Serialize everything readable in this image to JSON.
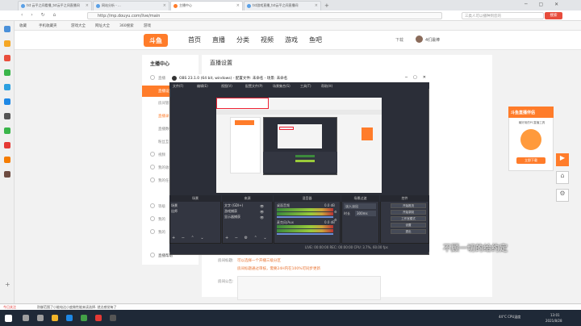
{
  "browser": {
    "tabs": [
      {
        "label": "tst 云平之间看播_tst云平之间直播间"
      },
      {
        "label": "网站分析 - ..."
      },
      {
        "label": "主播中心"
      },
      {
        "label": "tst游戏直播_tst云平之间直播间"
      }
    ],
    "url": "http://mp.douyu.com/live/main",
    "search_placeholder": "三类人可以播种到您的",
    "search_button": "搜索",
    "bookmarks": [
      "收藏",
      "手机收藏夹",
      "游戏大全",
      "网址大全",
      "360搜索",
      "游戏"
    ]
  },
  "site": {
    "logo": "斗鱼",
    "nav": [
      "首页",
      "直播",
      "分类",
      "视频",
      "游戏",
      "鱼吧"
    ],
    "download": "下载",
    "username": "4们最棒",
    "sidebar_title": "主播中心",
    "sidebar_items": [
      "直播",
      "直播设置",
      "房间管理",
      "直播录",
      "直播数据",
      "粉丝互动",
      "视频",
      "我的收益",
      "我的任务",
      "等级",
      "我的",
      "我的",
      "直播帮助"
    ],
    "content_title": "直播设置",
    "form_labels": [
      "房间标题:",
      "房间公告:"
    ],
    "form_notes": [
      "可以选择一个开播三级分区",
      "房间标题通过审核，需要24H内在100%可同步更新"
    ]
  },
  "obs": {
    "title": "OBS 23.1.0 (64 bit, windows) - 配置文件: 未命名 - 场景: 未命名",
    "menu": [
      "文件(F)",
      "编辑(E)",
      "视图(V)",
      "配置文件(P)",
      "场景集合(S)",
      "工具(T)",
      "帮助(H)"
    ],
    "panels": [
      "场景",
      "来源",
      "混音器",
      "场景过渡",
      "控件"
    ],
    "scenes": [
      "场景",
      "出师"
    ],
    "sources": [
      "文字 (GDI+)",
      "游戏捕获",
      "显示器捕获"
    ],
    "mixer": [
      {
        "label": "桌面音频",
        "level": "0.0 dB"
      },
      {
        "label": "麦克风/Aux",
        "level": "0.0 dB"
      }
    ],
    "transition": "淡入淡出",
    "duration_label": "时长",
    "duration": "300ms",
    "controls": [
      "开始推流",
      "开始录制",
      "工作室模式",
      "设置",
      "退出"
    ],
    "status": "LIVE: 00:00:00   REC: 00:00:00   CPU: 3.7%, 60.00 fps"
  },
  "promo": {
    "title": "斗鱼直播伴侣",
    "text": "最好用的PC直播工具",
    "button": "立即下载"
  },
  "subtitle": "不顾一切的给约定",
  "taskbar": {
    "notice": "今日关注",
    "toast": "防御范围了小能电达小度做性能来读选择. 就点感觉每了",
    "weather": "44°C CPU温度",
    "time": "13:01",
    "date": "2021/8/28"
  },
  "colors": {
    "accent": "#ff7c2a",
    "obs_bg": "#2b2e38"
  }
}
